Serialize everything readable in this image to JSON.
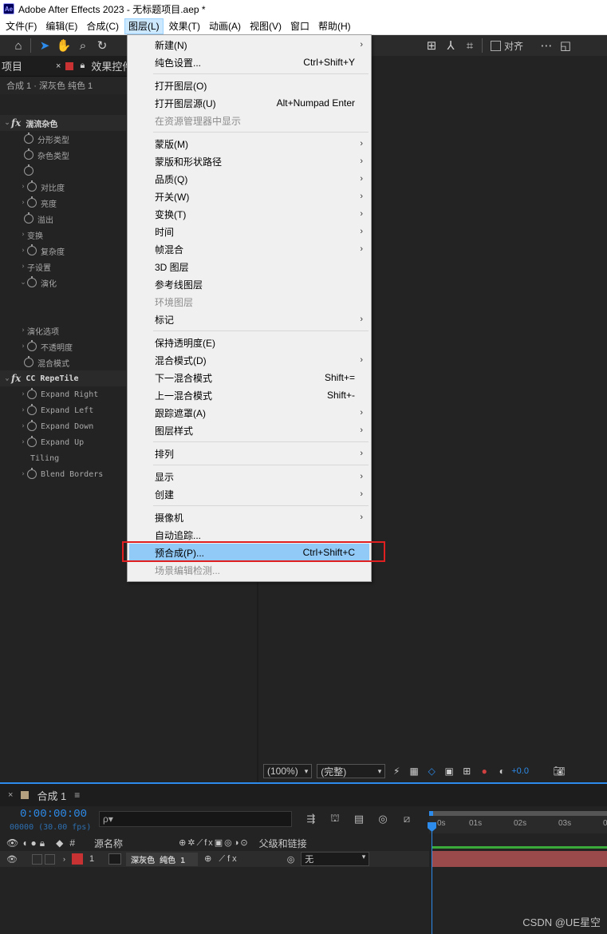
{
  "app": {
    "logo": "Ae",
    "title": "Adobe After Effects 2023 - 无标题项目.aep *"
  },
  "menubar": [
    "文件(F)",
    "编辑(E)",
    "合成(C)",
    "图层(L)",
    "效果(T)",
    "动画(A)",
    "视图(V)",
    "窗口",
    "帮助(H)"
  ],
  "toolbar": {
    "align_label": "对齐"
  },
  "left_panel": {
    "tab_project": "项目",
    "tab_effects": "效果控件",
    "breadcrumb": "合成 1 · 深灰色 纯色 1",
    "rows": [
      {
        "label": "湍流杂色",
        "kind": "fx"
      },
      {
        "label": "分形类型",
        "kind": "prop"
      },
      {
        "label": "杂色类型",
        "kind": "prop"
      },
      {
        "label": "",
        "kind": "prop"
      },
      {
        "label": "对比度",
        "kind": "twprop"
      },
      {
        "label": "亮度",
        "kind": "twprop"
      },
      {
        "label": "溢出",
        "kind": "prop"
      },
      {
        "label": "变换",
        "kind": "group"
      },
      {
        "label": "复杂度",
        "kind": "twprop"
      },
      {
        "label": "子设置",
        "kind": "group"
      },
      {
        "label": "演化",
        "kind": "openprop"
      },
      {
        "label": "演化选项",
        "kind": "group"
      },
      {
        "label": "不透明度",
        "kind": "twprop"
      },
      {
        "label": "混合模式",
        "kind": "prop"
      },
      {
        "label": "CC RepeTile",
        "kind": "fx"
      },
      {
        "label": "Expand Right",
        "kind": "twprop"
      },
      {
        "label": "Expand Left",
        "kind": "twprop"
      },
      {
        "label": "Expand Down",
        "kind": "twprop"
      },
      {
        "label": "Expand Up",
        "kind": "twprop"
      },
      {
        "label": "Tiling",
        "kind": "plain"
      },
      {
        "label": "Blend Borders",
        "kind": "twprop"
      }
    ]
  },
  "viewer": {
    "zoom": "(100%)",
    "quality": "(完整)",
    "exposure": "+0.0"
  },
  "layer_menu": {
    "items": [
      {
        "label": "新建(N)",
        "shortcut": "",
        "submenu": true,
        "disabled": false
      },
      {
        "label": "纯色设置...",
        "shortcut": "Ctrl+Shift+Y",
        "submenu": false,
        "disabled": false
      },
      {
        "sep": true
      },
      {
        "label": "打开图层(O)",
        "shortcut": "",
        "submenu": false,
        "disabled": false
      },
      {
        "label": "打开图层源(U)",
        "shortcut": "Alt+Numpad Enter",
        "submenu": false,
        "disabled": false
      },
      {
        "label": "在资源管理器中显示",
        "shortcut": "",
        "submenu": false,
        "disabled": true
      },
      {
        "sep": true
      },
      {
        "label": "蒙版(M)",
        "shortcut": "",
        "submenu": true,
        "disabled": false
      },
      {
        "label": "蒙版和形状路径",
        "shortcut": "",
        "submenu": true,
        "disabled": false
      },
      {
        "label": "品质(Q)",
        "shortcut": "",
        "submenu": true,
        "disabled": false
      },
      {
        "label": "开关(W)",
        "shortcut": "",
        "submenu": true,
        "disabled": false
      },
      {
        "label": "变换(T)",
        "shortcut": "",
        "submenu": true,
        "disabled": false
      },
      {
        "label": "时间",
        "shortcut": "",
        "submenu": true,
        "disabled": false
      },
      {
        "label": "帧混合",
        "shortcut": "",
        "submenu": true,
        "disabled": false
      },
      {
        "label": "3D 图层",
        "shortcut": "",
        "submenu": false,
        "disabled": false
      },
      {
        "label": "参考线图层",
        "shortcut": "",
        "submenu": false,
        "disabled": false
      },
      {
        "label": "环境图层",
        "shortcut": "",
        "submenu": false,
        "disabled": true
      },
      {
        "label": "标记",
        "shortcut": "",
        "submenu": true,
        "disabled": false
      },
      {
        "sep": true
      },
      {
        "label": "保持透明度(E)",
        "shortcut": "",
        "submenu": false,
        "disabled": false
      },
      {
        "label": "混合模式(D)",
        "shortcut": "",
        "submenu": true,
        "disabled": false
      },
      {
        "label": "下一混合模式",
        "shortcut": "Shift+=",
        "submenu": false,
        "disabled": false
      },
      {
        "label": "上一混合模式",
        "shortcut": "Shift+-",
        "submenu": false,
        "disabled": false
      },
      {
        "label": "跟踪遮罩(A)",
        "shortcut": "",
        "submenu": true,
        "disabled": false
      },
      {
        "label": "图层样式",
        "shortcut": "",
        "submenu": true,
        "disabled": false
      },
      {
        "sep": true
      },
      {
        "label": "排列",
        "shortcut": "",
        "submenu": true,
        "disabled": false
      },
      {
        "sep": true
      },
      {
        "label": "显示",
        "shortcut": "",
        "submenu": true,
        "disabled": false
      },
      {
        "label": "创建",
        "shortcut": "",
        "submenu": true,
        "disabled": false
      },
      {
        "sep": true
      },
      {
        "label": "摄像机",
        "shortcut": "",
        "submenu": true,
        "disabled": false
      },
      {
        "label": "自动追踪...",
        "shortcut": "",
        "submenu": false,
        "disabled": false
      },
      {
        "label": "预合成(P)...",
        "shortcut": "Ctrl+Shift+C",
        "submenu": false,
        "disabled": false,
        "highlighted": true
      },
      {
        "label": "场景编辑检测...",
        "shortcut": "",
        "submenu": false,
        "disabled": true
      }
    ]
  },
  "timeline": {
    "tab_label": "合成 1",
    "menu_glyph": "≡",
    "timecode": "0:00:00:00",
    "fps": "00000 (30.00 fps)",
    "search_placeholder": "ρ▾",
    "ruler_ticks": [
      "0s",
      "01s",
      "02s",
      "03s",
      "0"
    ],
    "col_source": "源名称",
    "col_parent": "父级和链接",
    "col_num": "#",
    "layer_num": "1",
    "layer_name": "深灰色 纯色 1",
    "layer_parent": "无"
  },
  "watermark": "CSDN @UE星空",
  "colors": {
    "accent": "#2d8ceb",
    "highlight": "#91c9f7",
    "layer_red": "#c93232",
    "annotation_red": "#e02020"
  }
}
